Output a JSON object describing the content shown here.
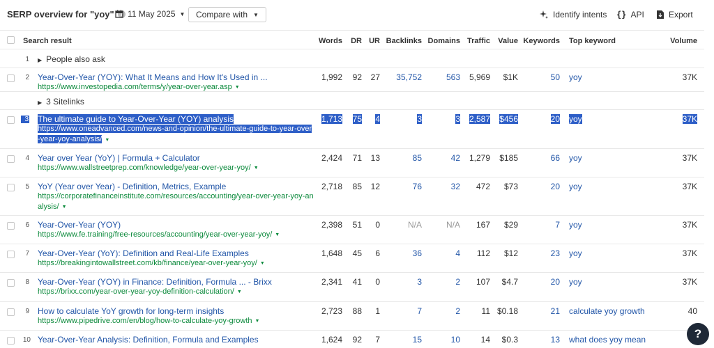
{
  "header": {
    "title": "SERP overview for \"yoy\"",
    "date": "11 May 2025",
    "compare": "Compare with",
    "identify_intents": "Identify intents",
    "api": "API",
    "export": "Export"
  },
  "columns": {
    "search_result": "Search result",
    "words": "Words",
    "dr": "DR",
    "ur": "UR",
    "backlinks": "Backlinks",
    "domains": "Domains",
    "traffic": "Traffic",
    "value": "Value",
    "keywords": "Keywords",
    "top_keyword": "Top keyword",
    "volume": "Volume"
  },
  "people_also_ask": {
    "rank": "1",
    "label": "People also ask"
  },
  "sitelinks": {
    "label": "3 Sitelinks"
  },
  "results": [
    {
      "rank": "2",
      "title": "Year-Over-Year (YOY): What It Means and How It's Used in ...",
      "url_lines": [
        "https://www.investopedia.com/terms/y/year-over-year.asp"
      ],
      "words": "1,992",
      "dr": "92",
      "ur": "27",
      "backlinks": "35,752",
      "domains": "563",
      "traffic": "5,969",
      "value": "$1K",
      "keywords": "50",
      "top_keyword": "yoy",
      "volume": "37K"
    },
    {
      "rank": "3",
      "title": "The ultimate guide to Year-Over-Year (YOY) analysis",
      "url_lines": [
        "https://www.oneadvanced.com/news-and-opinion/the-ultimate-guide-to-year-over",
        "-year-yoy-analysis/"
      ],
      "words": "1,713",
      "dr": "75",
      "ur": "4",
      "backlinks": "3",
      "domains": "3",
      "traffic": "2,587",
      "value": "$456",
      "keywords": "20",
      "top_keyword": "yoy",
      "volume": "37K"
    },
    {
      "rank": "4",
      "title": "Year over Year (YoY) | Formula + Calculator",
      "url_lines": [
        "https://www.wallstreetprep.com/knowledge/year-over-year-yoy/"
      ],
      "words": "2,424",
      "dr": "71",
      "ur": "13",
      "backlinks": "85",
      "domains": "42",
      "traffic": "1,279",
      "value": "$185",
      "keywords": "66",
      "top_keyword": "yoy",
      "volume": "37K"
    },
    {
      "rank": "5",
      "title": "YoY (Year over Year) - Definition, Metrics, Example",
      "url_lines": [
        "https://corporatefinanceinstitute.com/resources/accounting/year-over-year-yoy-an",
        "alysis/"
      ],
      "words": "2,718",
      "dr": "85",
      "ur": "12",
      "backlinks": "76",
      "domains": "32",
      "traffic": "472",
      "value": "$73",
      "keywords": "20",
      "top_keyword": "yoy",
      "volume": "37K"
    },
    {
      "rank": "6",
      "title": "Year-Over-Year (YOY)",
      "url_lines": [
        "https://www.fe.training/free-resources/accounting/year-over-year-yoy/"
      ],
      "words": "2,398",
      "dr": "51",
      "ur": "0",
      "backlinks": "N/A",
      "domains": "N/A",
      "traffic": "167",
      "value": "$29",
      "keywords": "7",
      "top_keyword": "yoy",
      "volume": "37K"
    },
    {
      "rank": "7",
      "title": "Year-Over-Year (YoY): Definition and Real-Life Examples",
      "url_lines": [
        "https://breakingintowallstreet.com/kb/finance/year-over-year-yoy/"
      ],
      "words": "1,648",
      "dr": "45",
      "ur": "6",
      "backlinks": "36",
      "domains": "4",
      "traffic": "112",
      "value": "$12",
      "keywords": "23",
      "top_keyword": "yoy",
      "volume": "37K"
    },
    {
      "rank": "8",
      "title": "Year-Over-Year (YOY) in Finance: Definition, Formula ... - Brixx",
      "url_lines": [
        "https://brixx.com/year-over-year-yoy-definition-calculation/"
      ],
      "words": "2,341",
      "dr": "41",
      "ur": "0",
      "backlinks": "3",
      "domains": "2",
      "traffic": "107",
      "value": "$4.7",
      "keywords": "20",
      "top_keyword": "yoy",
      "volume": "37K"
    },
    {
      "rank": "9",
      "title": "How to calculate YoY growth for long-term insights",
      "url_lines": [
        "https://www.pipedrive.com/en/blog/how-to-calculate-yoy-growth"
      ],
      "words": "2,723",
      "dr": "88",
      "ur": "1",
      "backlinks": "7",
      "domains": "2",
      "traffic": "11",
      "value": "$0.18",
      "keywords": "21",
      "top_keyword": "calculate yoy growth",
      "volume": "40"
    },
    {
      "rank": "10",
      "title": "Year-Over-Year Analysis: Definition, Formula and Examples",
      "url_lines": [],
      "words": "1,624",
      "dr": "92",
      "ur": "7",
      "backlinks": "15",
      "domains": "10",
      "traffic": "14",
      "value": "$0.3",
      "keywords": "13",
      "top_keyword": "what does yoy mean",
      "volume": ""
    }
  ],
  "help_fab": "?"
}
